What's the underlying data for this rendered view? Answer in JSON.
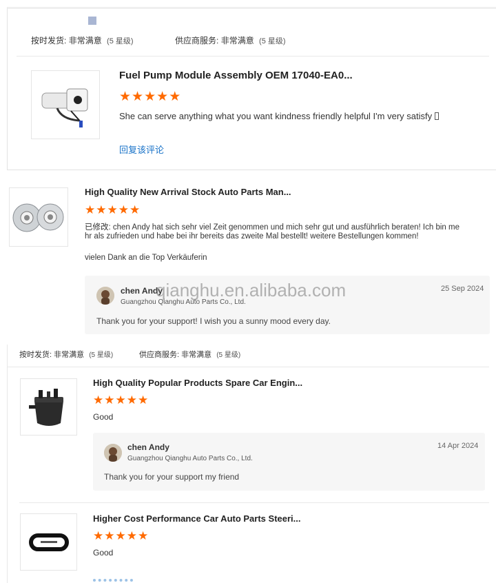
{
  "card1": {
    "rating_delivery_key": "按时发货:",
    "rating_delivery_val": "非常满意",
    "rating_delivery_stars": "(5 星级)",
    "rating_service_key": "供应商服务:",
    "rating_service_val": "非常满意",
    "rating_service_stars": "(5 星级)",
    "product_title": "Fuel Pump Module Assembly OEM 17040-EA0...",
    "rating": 5,
    "comment": "She can serve anything what you want kindness friendly helpful I'm very satisfy ",
    "reply_link": "回复该评论"
  },
  "card2": {
    "product_title": "High Quality New Arrival Stock Auto Parts Man...",
    "rating": 5,
    "comment_line1": "已修改: chen Andy hat sich sehr viel Zeit genommen und mich sehr gut und ausführlich beraten! Ich bin me",
    "comment_line2": "hr als zufrieden und habe bei ihr bereits das zweite Mal bestellt! weitere Bestellungen kommen!",
    "comment_line3": "vielen Dank an die Top Verkäuferin",
    "reply": {
      "name": "chen Andy",
      "company": "Guangzhou Qianghu Auto Parts Co., Ltd.",
      "date": "25 Sep 2024",
      "message": "Thank you for your support! I wish you a sunny mood every day."
    }
  },
  "watermark": "qianghu.en.alibaba.com",
  "card3": {
    "rating_delivery_key": "按时发货:",
    "rating_delivery_val": "非常满意",
    "rating_delivery_stars": "(5 星级)",
    "rating_service_key": "供应商服务:",
    "rating_service_val": "非常满意",
    "rating_service_stars": "(5 星级)",
    "product_title": "High Quality Popular Products Spare Car Engin...",
    "rating": 5,
    "comment": "Good",
    "reply": {
      "name": "chen Andy",
      "company": "Guangzhou Qianghu Auto Parts Co., Ltd.",
      "date": "14 Apr 2024",
      "message": "Thank you for your support my friend"
    }
  },
  "card4": {
    "product_title": "Higher Cost Performance Car Auto Parts Steeri...",
    "rating": 5,
    "comment": "Good"
  },
  "colors": {
    "star": "#ff6a00",
    "link": "#1a73c8",
    "reply_bg": "#f6f6f6"
  },
  "icons": [
    "fuel-pump-thumbnail",
    "brake-disc-thumbnail",
    "fuel-filter-thumbnail",
    "belt-thumbnail",
    "avatar-icon",
    "star-icon"
  ]
}
